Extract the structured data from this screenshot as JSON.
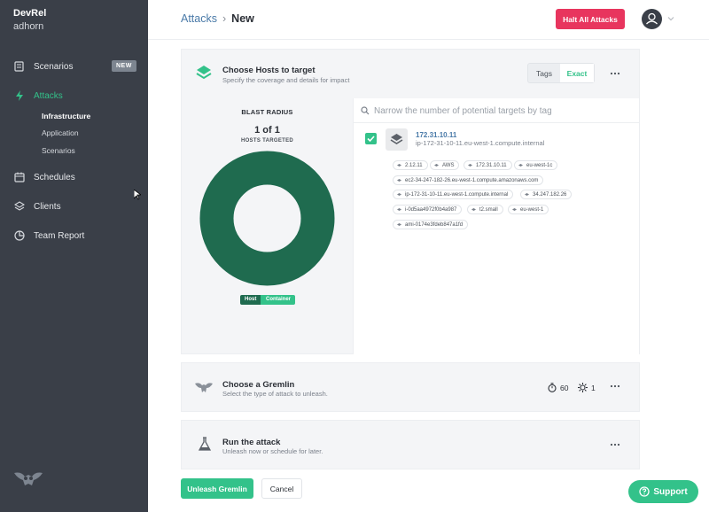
{
  "sidebar": {
    "org": "DevRel",
    "user": "adhorn",
    "items": [
      {
        "label": "Scenarios",
        "icon": "scenarios-icon",
        "badge": "NEW"
      },
      {
        "label": "Attacks",
        "icon": "bolt-icon",
        "active": true
      },
      {
        "label": "Schedules",
        "icon": "calendar-icon"
      },
      {
        "label": "Clients",
        "icon": "layers-icon"
      },
      {
        "label": "Team Report",
        "icon": "pie-chart-icon"
      }
    ],
    "subitems": [
      "Infrastructure",
      "Application",
      "Scenarios"
    ]
  },
  "header": {
    "breadcrumb_parent": "Attacks",
    "breadcrumb_sep": "›",
    "breadcrumb_current": "New",
    "halt_label": "Halt All Attacks"
  },
  "hosts_card": {
    "title": "Choose Hosts to target",
    "subtitle": "Specify the coverage and details for impact",
    "seg_tags": "Tags",
    "seg_exact": "Exact",
    "blast": {
      "title": "BLAST RADIUS",
      "count": "1 of 1",
      "label": "HOSTS TARGETED",
      "fraction": 1.0,
      "toggle_host": "Host",
      "toggle_container": "Container"
    },
    "search_placeholder": "Narrow the number of potential targets by tag",
    "host": {
      "ip": "172.31.10.11",
      "fqdn": "ip-172-31-10-11.eu-west-1.compute.internal",
      "checked": true,
      "tags": [
        "2.12.11",
        "AWS",
        "172.31.10.11",
        "eu-west-1c",
        "ec2-34-247-182-26.eu-west-1.compute.amazonaws.com",
        "ip-172-31-10-11.eu-west-1.compute.internal",
        "34.247.182.26",
        "i-0d5aa4972f0b4a987",
        "t2.small",
        "eu-west-1",
        "ami-0174e3fdeb847a1fd"
      ]
    }
  },
  "gremlin_card": {
    "title": "Choose a Gremlin",
    "subtitle": "Select the type of attack to unleash.",
    "length": "60",
    "cores": "1"
  },
  "run_card": {
    "title": "Run the attack",
    "subtitle": "Unleash now or schedule for later."
  },
  "footer": {
    "unleash_label": "Unleash Gremlin",
    "cancel_label": "Cancel",
    "support_label": "Support"
  },
  "colors": {
    "accent": "#33c28a",
    "danger": "#e8355e",
    "sidebar": "#3a3f48",
    "donut": "#1f6b4f"
  }
}
